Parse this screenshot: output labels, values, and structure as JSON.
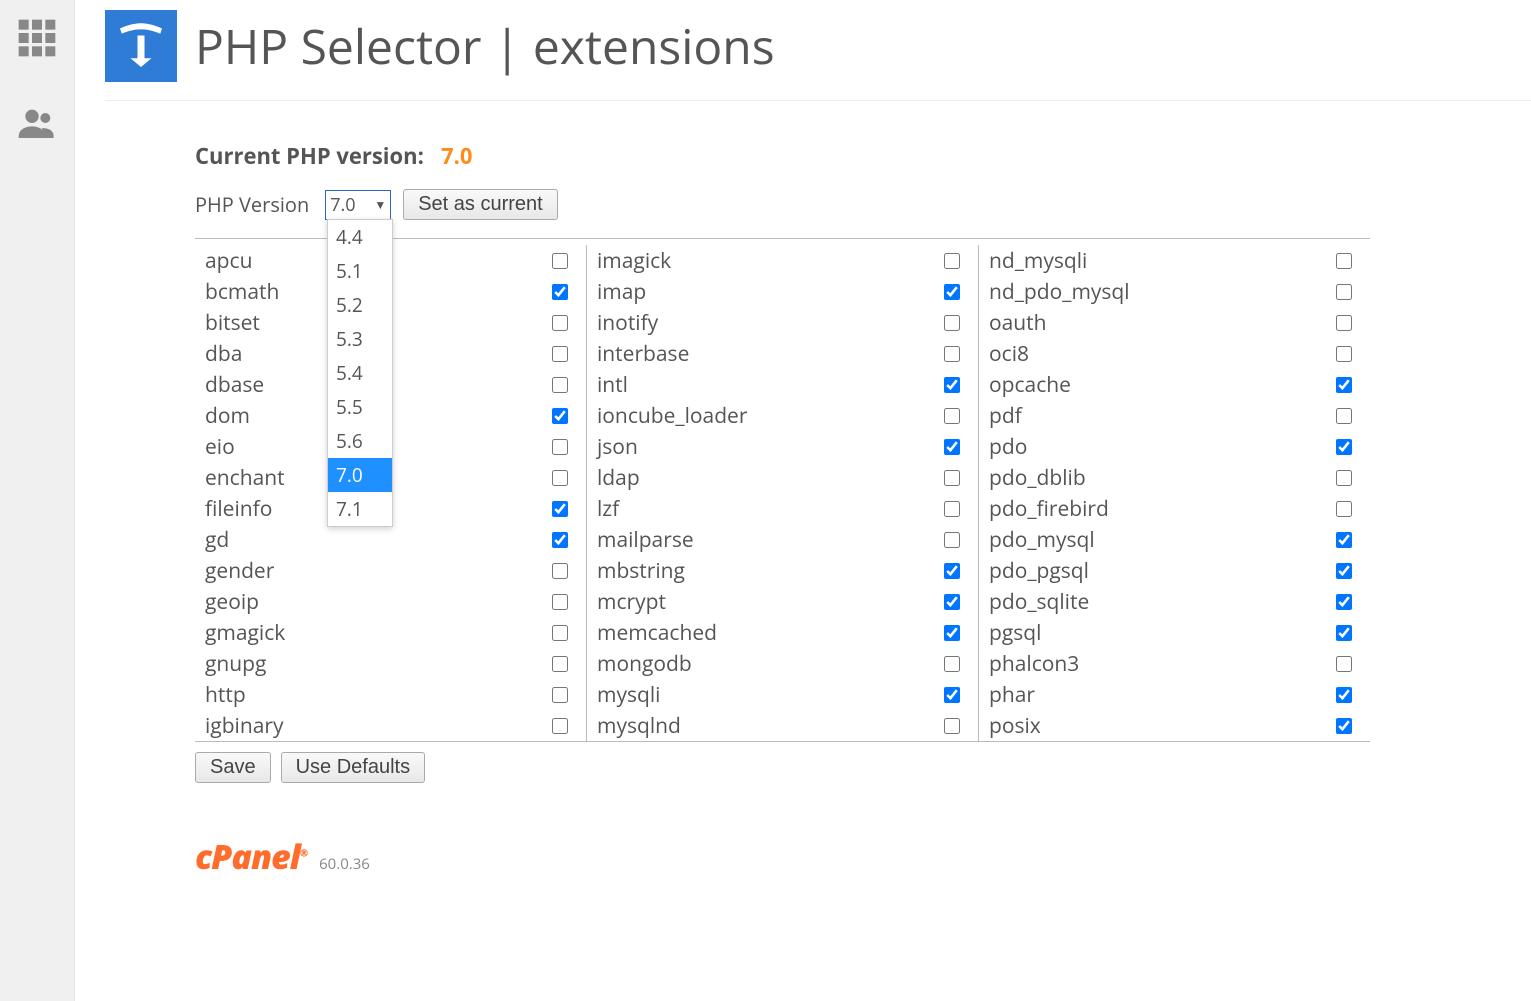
{
  "sidebar": {
    "grid_icon": "grid-apps",
    "users_icon": "users"
  },
  "header": {
    "title": "PHP Selector | extensions"
  },
  "current": {
    "label": "Current PHP version:",
    "value": "7.0"
  },
  "selector": {
    "label": "PHP Version",
    "selected": "7.0",
    "options": [
      "4.4",
      "5.1",
      "5.2",
      "5.3",
      "5.4",
      "5.5",
      "5.6",
      "7.0",
      "7.1"
    ],
    "set_button": "Set as current"
  },
  "extensions": {
    "col1": [
      {
        "name": "apcu",
        "checked": false
      },
      {
        "name": "bcmath",
        "checked": true
      },
      {
        "name": "bitset",
        "checked": false
      },
      {
        "name": "dba",
        "checked": false
      },
      {
        "name": "dbase",
        "checked": false
      },
      {
        "name": "dom",
        "checked": true
      },
      {
        "name": "eio",
        "checked": false
      },
      {
        "name": "enchant",
        "checked": false
      },
      {
        "name": "fileinfo",
        "checked": true
      },
      {
        "name": "gd",
        "checked": true
      },
      {
        "name": "gender",
        "checked": false
      },
      {
        "name": "geoip",
        "checked": false
      },
      {
        "name": "gmagick",
        "checked": false
      },
      {
        "name": "gnupg",
        "checked": false
      },
      {
        "name": "http",
        "checked": false
      },
      {
        "name": "igbinary",
        "checked": false
      }
    ],
    "col2": [
      {
        "name": "imagick",
        "checked": false
      },
      {
        "name": "imap",
        "checked": true
      },
      {
        "name": "inotify",
        "checked": false
      },
      {
        "name": "interbase",
        "checked": false
      },
      {
        "name": "intl",
        "checked": true
      },
      {
        "name": "ioncube_loader",
        "checked": false
      },
      {
        "name": "json",
        "checked": true
      },
      {
        "name": "ldap",
        "checked": false
      },
      {
        "name": "lzf",
        "checked": false
      },
      {
        "name": "mailparse",
        "checked": false
      },
      {
        "name": "mbstring",
        "checked": true
      },
      {
        "name": "mcrypt",
        "checked": true
      },
      {
        "name": "memcached",
        "checked": true
      },
      {
        "name": "mongodb",
        "checked": false
      },
      {
        "name": "mysqli",
        "checked": true
      },
      {
        "name": "mysqlnd",
        "checked": false
      }
    ],
    "col3": [
      {
        "name": "nd_mysqli",
        "checked": false
      },
      {
        "name": "nd_pdo_mysql",
        "checked": false
      },
      {
        "name": "oauth",
        "checked": false
      },
      {
        "name": "oci8",
        "checked": false
      },
      {
        "name": "opcache",
        "checked": true
      },
      {
        "name": "pdf",
        "checked": false
      },
      {
        "name": "pdo",
        "checked": true
      },
      {
        "name": "pdo_dblib",
        "checked": false
      },
      {
        "name": "pdo_firebird",
        "checked": false
      },
      {
        "name": "pdo_mysql",
        "checked": true
      },
      {
        "name": "pdo_pgsql",
        "checked": true
      },
      {
        "name": "pdo_sqlite",
        "checked": true
      },
      {
        "name": "pgsql",
        "checked": true
      },
      {
        "name": "phalcon3",
        "checked": false
      },
      {
        "name": "phar",
        "checked": true
      },
      {
        "name": "posix",
        "checked": true
      }
    ]
  },
  "actions": {
    "save": "Save",
    "defaults": "Use Defaults"
  },
  "footer": {
    "logo": "cPanel",
    "version": "60.0.36"
  }
}
